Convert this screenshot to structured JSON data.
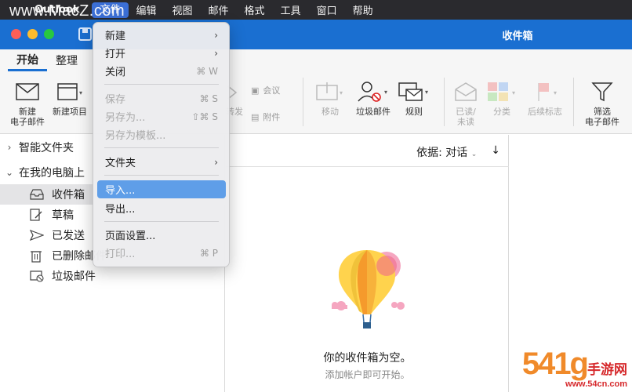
{
  "menubar": {
    "app_name": "Outlook",
    "items": [
      "文件",
      "编辑",
      "视图",
      "邮件",
      "格式",
      "工具",
      "窗口",
      "帮助"
    ]
  },
  "watermark_top": "www.MacZ.com",
  "window": {
    "title": "收件箱"
  },
  "ribbon": {
    "tabs": [
      "开始",
      "整理"
    ],
    "new_email": "新建\n电子邮件",
    "new_email_l1": "新建",
    "new_email_l2": "电子邮件",
    "new_item": "新建项目",
    "forward": "转发",
    "meeting": "会议",
    "attachment": "附件",
    "move": "移动",
    "junk": "垃圾邮件",
    "rules": "规则",
    "read_unread_l1": "已读/",
    "read_unread_l2": "未读",
    "categorize": "分类",
    "followup": "后续标志",
    "filter_l1": "筛选",
    "filter_l2": "电子邮件"
  },
  "sidebar": {
    "groups": [
      "智能文件夹",
      "在我的电脑上"
    ],
    "folders": [
      "收件箱",
      "草稿",
      "已发送",
      "已删除邮件",
      "垃圾邮件"
    ]
  },
  "message_list": {
    "sort_label": "依据: 对话",
    "empty_title": "你的收件箱为空。",
    "empty_sub": "添加帐户即可开始。"
  },
  "file_menu": {
    "new": "新建",
    "open": "打开",
    "close": "关闭",
    "close_sc": "⌘ W",
    "save": "保存",
    "save_sc": "⌘ S",
    "save_as": "另存为...",
    "save_as_sc": "⇧⌘ S",
    "save_template": "另存为模板...",
    "folder": "文件夹",
    "import": "导入...",
    "export": "导出...",
    "page_setup": "页面设置...",
    "print": "打印...",
    "print_sc": "⌘ P"
  },
  "watermark_br": {
    "big": "54",
    "big2": "1g",
    "cn": "手游网",
    "url": "www.54cn.com"
  },
  "colors": {
    "accent": "#1a6fd1",
    "highlight": "#5f9ee8",
    "menubar": "#2a2a2e"
  }
}
